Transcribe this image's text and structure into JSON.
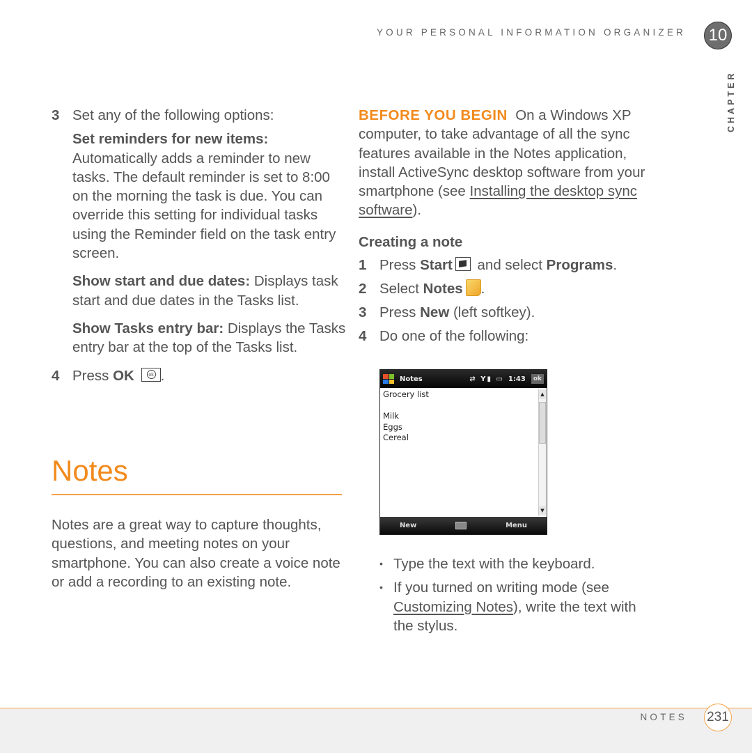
{
  "header": {
    "running_title": "YOUR PERSONAL INFORMATION ORGANIZER",
    "chapter_number": "10",
    "chapter_label": "CHAPTER"
  },
  "left_column": {
    "step3": {
      "num": "3",
      "text": "Set any of the following options:"
    },
    "options": [
      {
        "term": "Set reminders for new items:",
        "desc": "Automatically adds a reminder to new tasks. The default reminder is set to 8:00 on the morning the task is due. You can override this setting for individual tasks using the Reminder field on the task entry screen."
      },
      {
        "term": "Show start and due dates:",
        "desc": "Displays task start and due dates in the Tasks list."
      },
      {
        "term": "Show Tasks entry bar:",
        "desc": "Displays the Tasks entry bar at the top of the Tasks list."
      }
    ],
    "step4": {
      "num": "4",
      "prefix": "Press ",
      "bold": "OK",
      "key_icon": "ok",
      "suffix": "."
    }
  },
  "section": {
    "title": "Notes",
    "intro": "Notes are a great way to capture thoughts, questions, and meeting notes on your smartphone. You can also create a voice note or add a recording to an existing note."
  },
  "right_column": {
    "before_label": "BEFORE YOU BEGIN",
    "before_text_1": "On a Windows XP computer, to take advantage of all the sync features available in the Notes application, install ActiveSync desktop software from your smartphone (see ",
    "before_link": "Installing the desktop sync software",
    "before_text_2": ").",
    "subhead": "Creating a note",
    "steps": [
      {
        "num": "1",
        "a": "Press ",
        "b": "Start",
        "c": " and select ",
        "d": "Programs",
        "e": "."
      },
      {
        "num": "2",
        "a": "Select ",
        "b": "Notes",
        "e": "."
      },
      {
        "num": "3",
        "a": "Press ",
        "b": "New",
        "c": " (left softkey)."
      },
      {
        "num": "4",
        "a": "Do one of the following:"
      }
    ],
    "bullets": [
      {
        "text": "Type the text with the keyboard."
      },
      {
        "pre": "If you turned on writing mode (see ",
        "link": "Customizing Notes",
        "post": "), write the text with the stylus."
      }
    ]
  },
  "phone_screen": {
    "app_title": "Notes",
    "time": "1:43",
    "ok_label": "ok",
    "note_lines": [
      "Grocery list",
      "",
      "Milk",
      "Eggs",
      "Cereal"
    ],
    "left_softkey": "New",
    "right_softkey": "Menu"
  },
  "footer": {
    "section_label": "NOTES",
    "page_number": "231"
  },
  "colors": {
    "accent_orange": "#f28a1d",
    "rule_orange": "#f7a24a",
    "chapter_badge_gray": "#6e6e6e",
    "body_text": "#555555",
    "footer_bg": "#f0f0f0"
  }
}
